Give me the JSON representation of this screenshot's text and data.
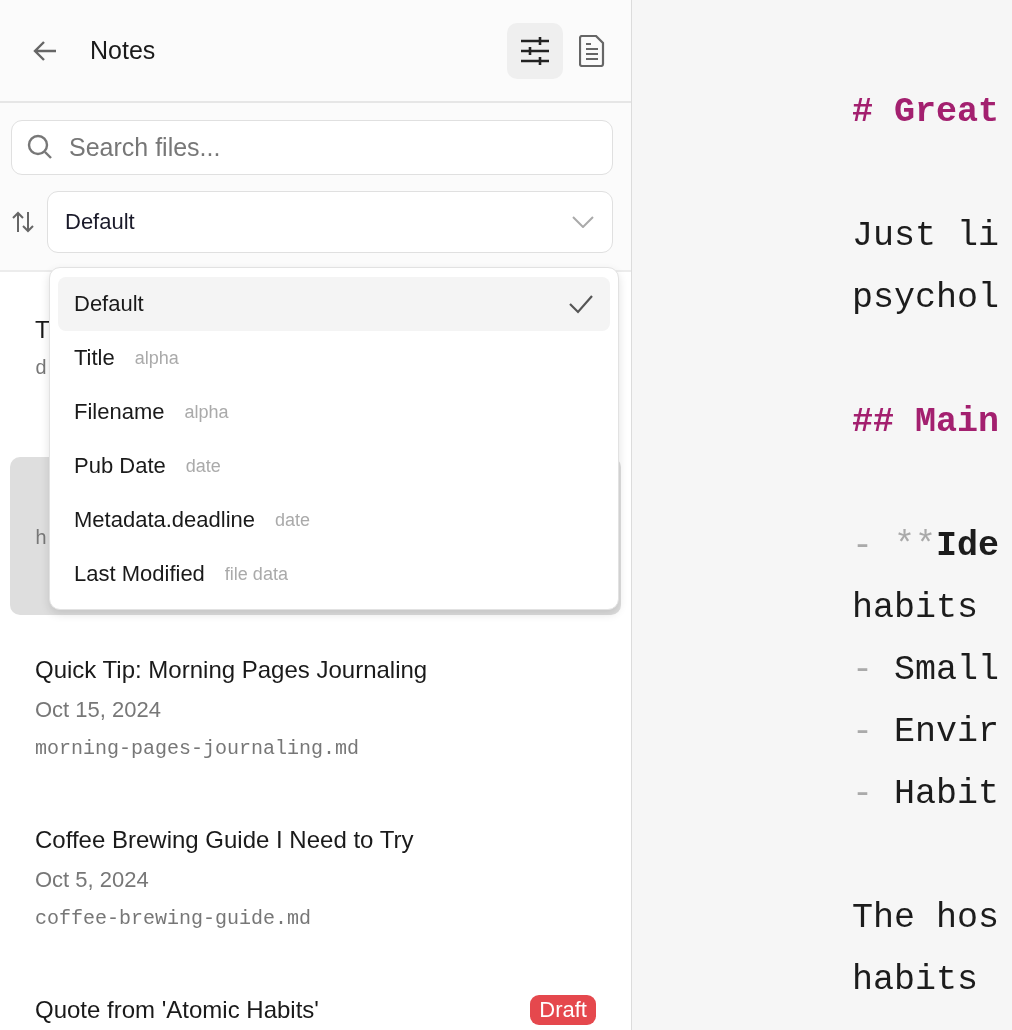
{
  "header": {
    "title": "Notes",
    "filter_button": {
      "active": true
    }
  },
  "search": {
    "placeholder": "Search files..."
  },
  "sort": {
    "value": "Default",
    "open": true,
    "options": [
      {
        "label": "Default",
        "selected": true
      },
      {
        "label": "Title",
        "hint": "alpha",
        "selected": false
      },
      {
        "label": "Filename",
        "hint": "alpha",
        "selected": false
      },
      {
        "label": "Pub Date",
        "hint": "date",
        "selected": false
      },
      {
        "label": "Metadata.deadline",
        "hint": "date",
        "selected": false
      },
      {
        "label": "Last Modified",
        "hint": "file data",
        "selected": false
      }
    ]
  },
  "files": [
    {
      "title": "T",
      "filename": "d",
      "selected": false
    },
    {
      "filename": "h",
      "selected": true
    },
    {
      "title": "Quick Tip: Morning Pages Journaling",
      "date": "Oct 15, 2024",
      "filename": "morning-pages-journaling.md",
      "selected": false
    },
    {
      "title": "Coffee Brewing Guide I Need to Try",
      "date": "Oct 5, 2024",
      "filename": "coffee-brewing-guide.md",
      "selected": false
    },
    {
      "title": "Quote from 'Atomic Habits'",
      "badge": "Draft",
      "selected": false
    }
  ],
  "editor": {
    "lines": [
      {
        "kind": "heading",
        "text": "# Great"
      },
      {
        "kind": "blank"
      },
      {
        "kind": "text",
        "text": "Just li"
      },
      {
        "kind": "text",
        "text": "psychol"
      },
      {
        "kind": "blank"
      },
      {
        "kind": "heading",
        "text": "## Main"
      },
      {
        "kind": "blank"
      },
      {
        "kind": "list",
        "marker": "-",
        "syntax": "**",
        "bold": "Ide"
      },
      {
        "kind": "text",
        "text": "habits"
      },
      {
        "kind": "list",
        "marker": "-",
        "text": "Small"
      },
      {
        "kind": "list",
        "marker": "-",
        "text": "Envir"
      },
      {
        "kind": "list",
        "marker": "-",
        "text": "Habit"
      },
      {
        "kind": "blank"
      },
      {
        "kind": "text",
        "text": "The hos"
      },
      {
        "kind": "text",
        "text": "habits"
      }
    ]
  }
}
